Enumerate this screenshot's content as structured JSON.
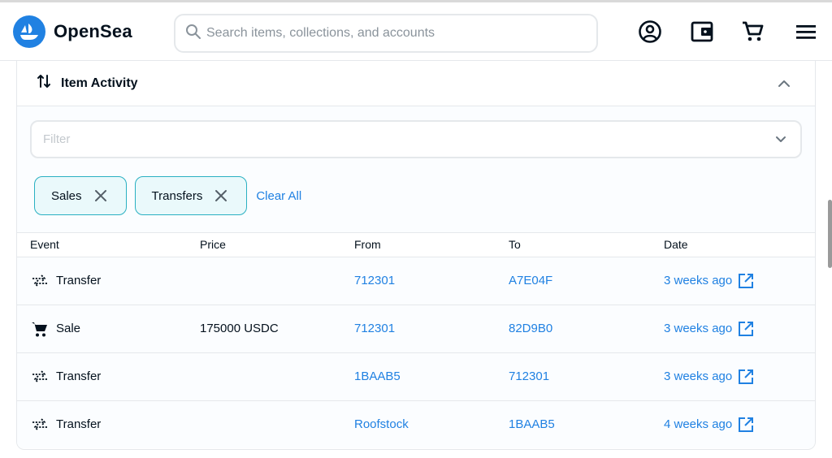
{
  "app": {
    "name": "OpenSea"
  },
  "search": {
    "placeholder": "Search items, collections, and accounts"
  },
  "header_icons": [
    "account-icon",
    "wallet-icon",
    "cart-icon",
    "menu-icon"
  ],
  "colors": {
    "brand": "#2081e2",
    "chip_border": "#2ab0c2",
    "chip_bg": "#eaf9fb"
  },
  "activity": {
    "title": "Item Activity",
    "filter_placeholder": "Filter",
    "chips": [
      {
        "label": "Sales"
      },
      {
        "label": "Transfers"
      }
    ],
    "clear_all": "Clear All",
    "columns": [
      "Event",
      "Price",
      "From",
      "To",
      "Date"
    ],
    "rows": [
      {
        "event": "Transfer",
        "icon": "transfer-icon",
        "price": "",
        "from": "712301",
        "to": "A7E04F",
        "date": "3 weeks ago"
      },
      {
        "event": "Sale",
        "icon": "cart-icon",
        "price": "175000 USDC",
        "from": "712301",
        "to": "82D9B0",
        "date": "3 weeks ago"
      },
      {
        "event": "Transfer",
        "icon": "transfer-icon",
        "price": "",
        "from": "1BAAB5",
        "to": "712301",
        "date": "3 weeks ago"
      },
      {
        "event": "Transfer",
        "icon": "transfer-icon",
        "price": "",
        "from": "Roofstock",
        "to": "1BAAB5",
        "date": "4 weeks ago"
      }
    ]
  }
}
